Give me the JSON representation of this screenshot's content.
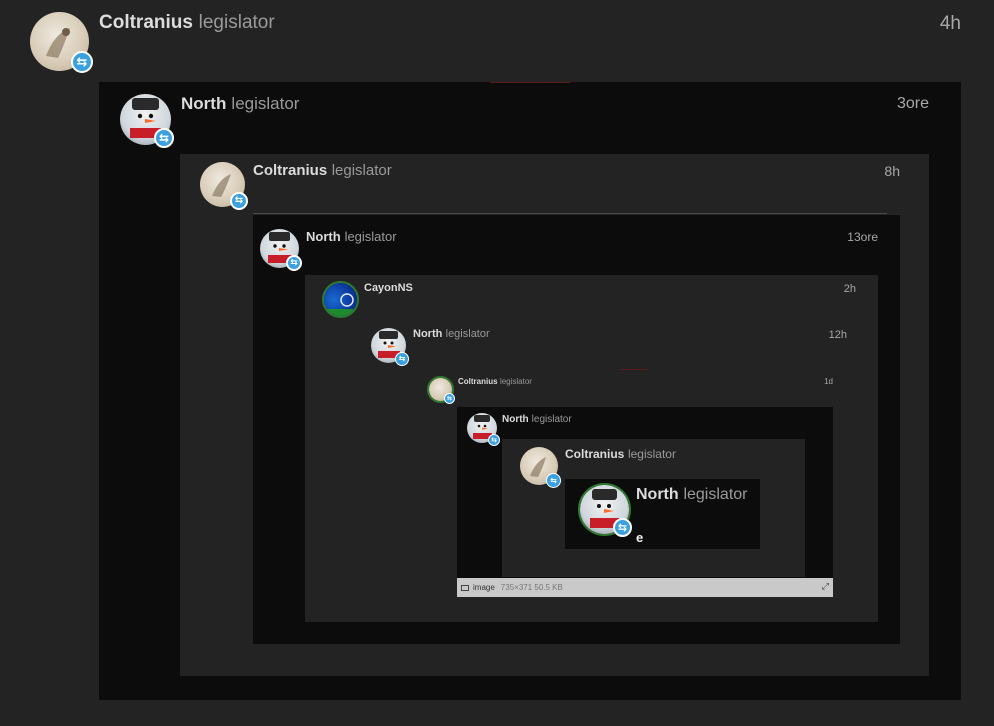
{
  "posts": [
    {
      "author": "Coltranius",
      "role": "legislator",
      "time": "4h"
    },
    {
      "author": "North",
      "role": "legislator",
      "time": "3ore"
    },
    {
      "author": "Coltranius",
      "role": "legislator",
      "time": "8h"
    },
    {
      "author": "North",
      "role": "legislator",
      "time": "13ore"
    },
    {
      "author": "CayonNS",
      "role": "",
      "time": "2h"
    },
    {
      "author": "North",
      "role": "legislator",
      "time": "12h"
    },
    {
      "author": "Coltranius",
      "role": "legislator",
      "time": "1d"
    },
    {
      "author": "North",
      "role": "legislator",
      "time": ""
    },
    {
      "author": "Coltranius",
      "role": "legislator",
      "time": ""
    },
    {
      "author": "North",
      "role": "legislator",
      "time": "",
      "message": "e"
    }
  ],
  "image_bar": {
    "label": "image",
    "meta": "735×371 50.5 KB",
    "expand_icon": "expand-icon"
  },
  "colors": {
    "badge": "#3aa0e0",
    "panel_dark": "#0c0c0c",
    "panel_gray": "#232323"
  }
}
